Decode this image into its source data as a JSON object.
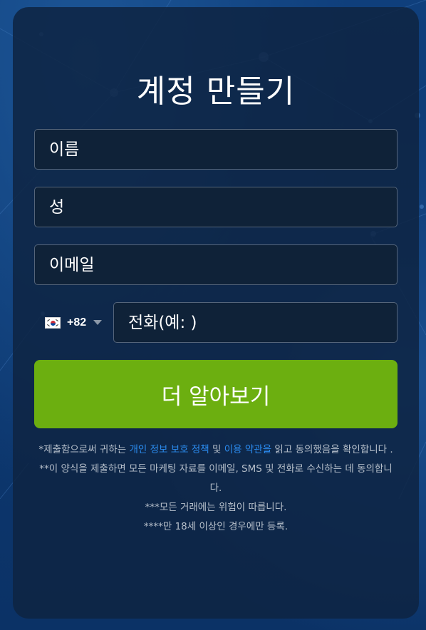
{
  "form": {
    "title": "계정 만들기",
    "first_name_placeholder": "이름",
    "last_name_placeholder": "성",
    "email_placeholder": "이메일",
    "phone_country_code": "+82",
    "phone_placeholder": "전화(예: )",
    "submit_label": "더 알아보기"
  },
  "disclaimer": {
    "line1_prefix": "*제출함으로써 귀하는 ",
    "privacy_link": "개인 정보 보호 정책",
    "line1_mid": " 및 ",
    "terms_link": "이용 약관을",
    "line1_suffix": " 읽고 동의했음을 확인합니다 .",
    "line2": "**이 양식을 제출하면 모든 마케팅 자료를 이메일, SMS 및 전화로 수신하는 데 동의합니다.",
    "line3": "***모든 거래에는 위험이 따릅니다.",
    "line4": "****만 18세 이상인 경우에만 등록."
  },
  "colors": {
    "button": "#6caf10",
    "link": "#2b8cf0",
    "card": "#0e2442"
  }
}
